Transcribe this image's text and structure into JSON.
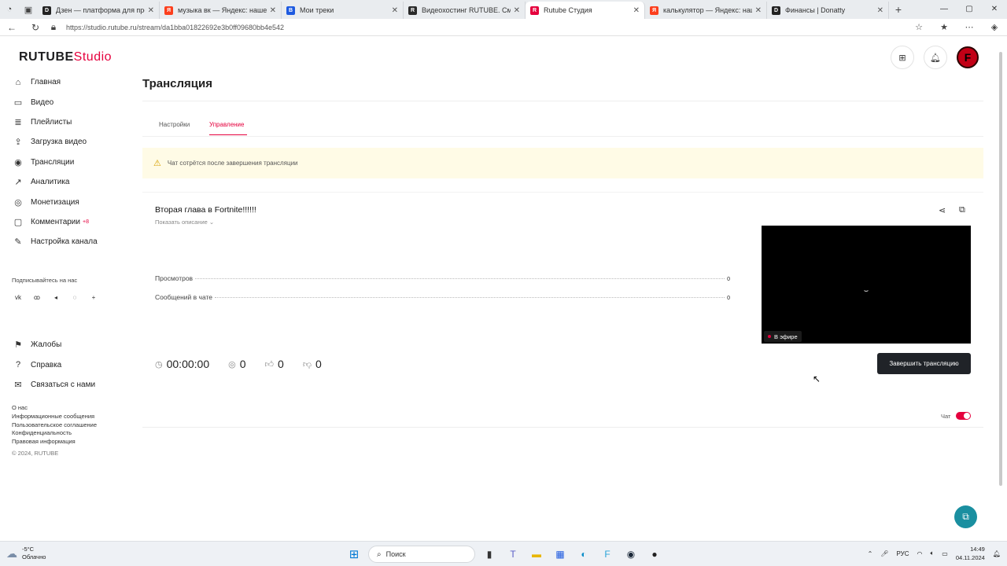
{
  "browser": {
    "tabs": [
      {
        "title": "Дзен — платформа для просм...",
        "fav_color": "#222222",
        "fav_char": "D"
      },
      {
        "title": "музыка вк — Яндекс: нашелся...",
        "fav_color": "#fc3f1d",
        "fav_char": "Я"
      },
      {
        "title": "Мои треки",
        "fav_color": "#1e5ae0",
        "fav_char": "B"
      },
      {
        "title": "Видеохостинг RUTUBE. Смотри...",
        "fav_color": "#2a2a2a",
        "fav_char": "R"
      },
      {
        "title": "Rutube Студия",
        "fav_color": "#e5003d",
        "fav_char": "R",
        "active": true
      },
      {
        "title": "калькулятор — Яндекс: нашло...",
        "fav_color": "#fc3f1d",
        "fav_char": "Я"
      },
      {
        "title": "Финансы | Donatty",
        "fav_color": "#222222",
        "fav_char": "D"
      }
    ],
    "url": "https://studio.rutube.ru/stream/da1bba01822692e3b0ff09680bb4e542"
  },
  "logo": {
    "brand": "RUTUBE",
    "product": "Studio"
  },
  "sidebar": {
    "items": [
      {
        "label": "Главная",
        "icon": "home-icon",
        "glyph": "⌂"
      },
      {
        "label": "Видео",
        "icon": "video-icon",
        "glyph": "▭"
      },
      {
        "label": "Плейлисты",
        "icon": "playlist-icon",
        "glyph": "≣"
      },
      {
        "label": "Загрузка видео",
        "icon": "upload-icon",
        "glyph": "⇪"
      },
      {
        "label": "Трансляции",
        "icon": "broadcast-icon",
        "glyph": "◉"
      },
      {
        "label": "Аналитика",
        "icon": "analytics-icon",
        "glyph": "↗"
      },
      {
        "label": "Монетизация",
        "icon": "monetization-icon",
        "glyph": "◎"
      },
      {
        "label": "Комментарии",
        "icon": "comments-icon",
        "glyph": "▢",
        "badge": "+8"
      },
      {
        "label": "Настройка канала",
        "icon": "settings-icon",
        "glyph": "✎"
      }
    ],
    "follow_label": "Подписывайтесь на нас",
    "socials": [
      {
        "name": "vk-icon",
        "glyph": "vk"
      },
      {
        "name": "ok-icon",
        "glyph": "ꝏ"
      },
      {
        "name": "telegram-icon",
        "glyph": "◂"
      },
      {
        "name": "viber-icon",
        "glyph": "◌"
      },
      {
        "name": "plus-icon",
        "glyph": "+"
      }
    ],
    "secondary": [
      {
        "label": "Жалобы",
        "icon": "flag-icon",
        "glyph": "⚑"
      },
      {
        "label": "Справка",
        "icon": "help-icon",
        "glyph": "?"
      },
      {
        "label": "Связаться с нами",
        "icon": "chat-icon",
        "glyph": "✉"
      }
    ],
    "footer": [
      "О нас",
      "Информационные сообщения",
      "Пользовательское соглашение",
      "Конфиденциальность",
      "Правовая информация"
    ],
    "copyright": "© 2024, RUTUBE"
  },
  "main": {
    "page_title": "Трансляция",
    "tabs": [
      {
        "label": "Настройки",
        "active": false
      },
      {
        "label": "Управление",
        "active": true
      }
    ],
    "warning": "Чат сотрётся после завершения трансляции",
    "stream": {
      "title": "Вторая глава в Fortnite!!!!!!",
      "description_toggle": "Показать описание",
      "stats": [
        {
          "label": "Просмотров",
          "value": "0"
        },
        {
          "label": "Сообщений в чате",
          "value": "0"
        }
      ],
      "timer": "00:00:00",
      "viewers": "0",
      "likes": "0",
      "dislikes": "0",
      "live_badge": "В эфире",
      "end_button": "Завершить трансляцию"
    },
    "chat": {
      "label": "Чат",
      "enabled": true
    }
  },
  "taskbar": {
    "weather_temp": "-5°C",
    "weather_desc": "Облачно",
    "search_placeholder": "Поиск",
    "lang": "РУС",
    "time": "14:49",
    "date": "04.11.2024"
  },
  "colors": {
    "accent": "#e5003d",
    "warning_bg": "#fffbe6",
    "fab": "#1a8fa0"
  }
}
